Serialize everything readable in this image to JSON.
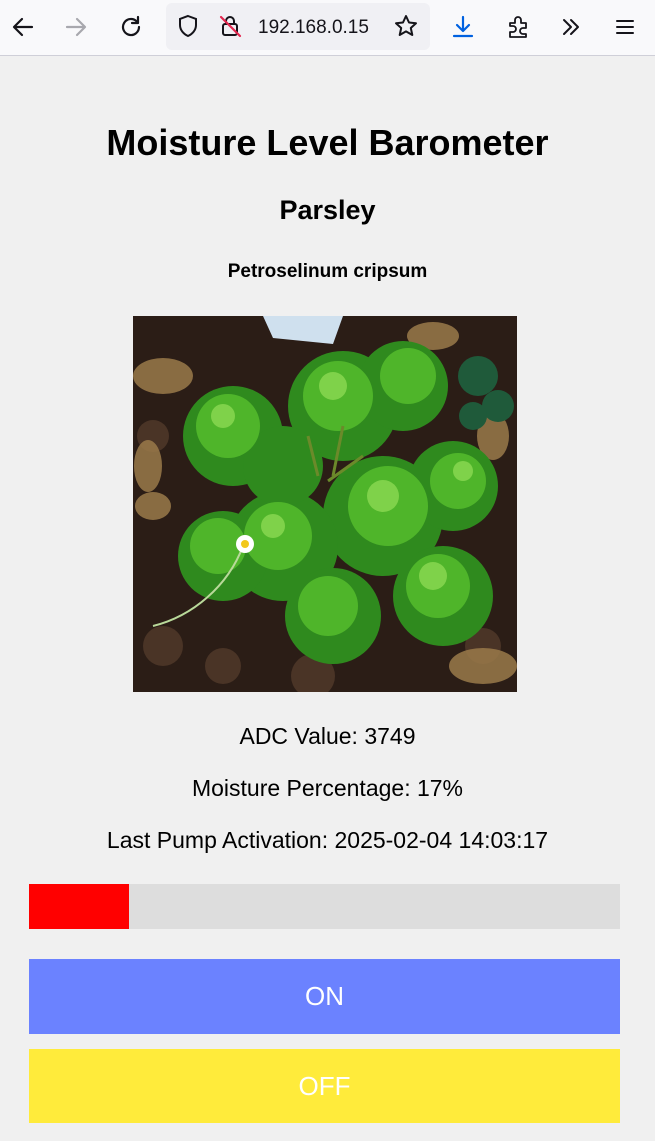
{
  "browser": {
    "url": "192.168.0.15",
    "icons": [
      "back-icon",
      "forward-icon",
      "reload-icon",
      "shield-icon",
      "insecure-lock-icon",
      "bookmark-star-icon",
      "download-icon",
      "extensions-icon",
      "overflow-icon",
      "menu-icon"
    ]
  },
  "page": {
    "title": "Moisture Level Barometer",
    "plant_name": "Parsley",
    "latin_name": "Petroselinum cripsum",
    "adc_text": "ADC Value: 3749",
    "moisture_text": "Moisture Percentage: 17%",
    "pump_text": "Last Pump Activation: 2025-02-04 14:03:17",
    "moisture_percent": 17,
    "bar_fill_color": "#ff0000",
    "bar_track_color": "#dddddd",
    "on_button": {
      "label": "ON",
      "color": "#6b82ff"
    },
    "off_button": {
      "label": "OFF",
      "color": "#ffeb3b"
    }
  }
}
